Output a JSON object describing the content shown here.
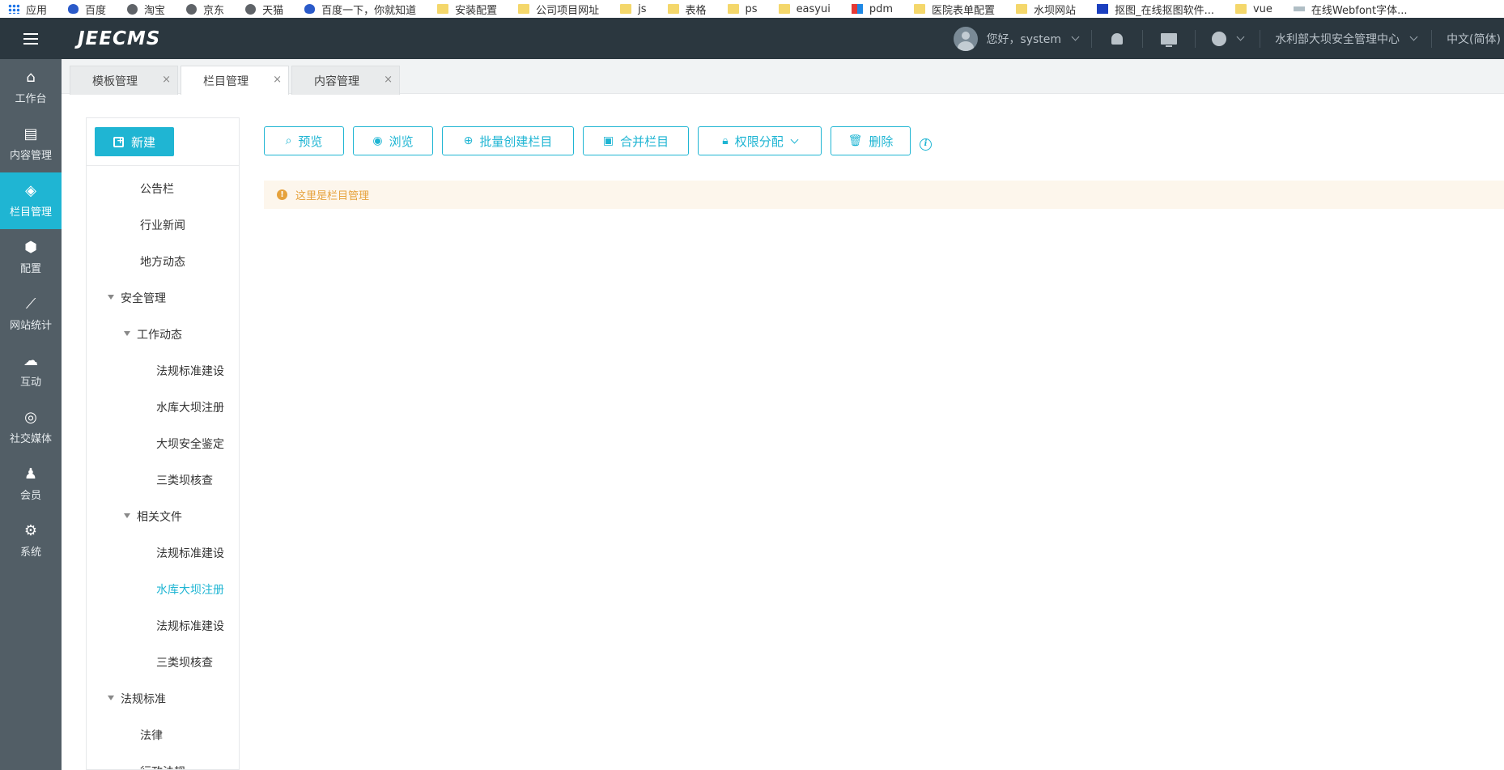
{
  "bookmarks": [
    {
      "label": "应用",
      "icon": "apps"
    },
    {
      "label": "百度",
      "icon": "paw"
    },
    {
      "label": "淘宝",
      "icon": "globe"
    },
    {
      "label": "京东",
      "icon": "globe"
    },
    {
      "label": "天猫",
      "icon": "globe"
    },
    {
      "label": "百度一下，你就知道",
      "icon": "paw"
    },
    {
      "label": "安装配置",
      "icon": "folder"
    },
    {
      "label": "公司项目网址",
      "icon": "folder"
    },
    {
      "label": "js",
      "icon": "folder"
    },
    {
      "label": "表格",
      "icon": "folder"
    },
    {
      "label": "ps",
      "icon": "folder"
    },
    {
      "label": "easyui",
      "icon": "folder"
    },
    {
      "label": "pdm",
      "icon": "pdm"
    },
    {
      "label": "医院表单配置",
      "icon": "folder"
    },
    {
      "label": "水坝网站",
      "icon": "folder"
    },
    {
      "label": "抠图_在线抠图软件...",
      "icon": "kou"
    },
    {
      "label": "vue",
      "icon": "folder"
    },
    {
      "label": "在线Webfont字体...",
      "icon": "web"
    }
  ],
  "header": {
    "logo": "JEECMS",
    "user_greeting": "您好，system",
    "site_name": "水利部大坝安全管理中心",
    "language": "中文(简体)"
  },
  "sidebar": {
    "items": [
      {
        "label": "工作台",
        "icon": "home-icon",
        "glyph": "⌂"
      },
      {
        "label": "内容管理",
        "icon": "document-icon",
        "glyph": "▤"
      },
      {
        "label": "栏目管理",
        "icon": "layers-icon",
        "glyph": "◈"
      },
      {
        "label": "配置",
        "icon": "cube-icon",
        "glyph": "⬢"
      },
      {
        "label": "网站统计",
        "icon": "chart-icon",
        "glyph": "⟋"
      },
      {
        "label": "互动",
        "icon": "chat-icon",
        "glyph": "☁"
      },
      {
        "label": "社交媒体",
        "icon": "target-icon",
        "glyph": "◎"
      },
      {
        "label": "会员",
        "icon": "member-icon",
        "glyph": "♟"
      },
      {
        "label": "系统",
        "icon": "gear-icon",
        "glyph": "⚙"
      }
    ]
  },
  "tabs": [
    {
      "label": "模板管理",
      "close": "×"
    },
    {
      "label": "栏目管理",
      "close": "×"
    },
    {
      "label": "内容管理",
      "close": "×"
    }
  ],
  "tree": {
    "new_button": "新建",
    "nodes": [
      {
        "label": "公告栏"
      },
      {
        "label": "行业新闻"
      },
      {
        "label": "地方动态"
      },
      {
        "label": "安全管理"
      },
      {
        "label": "工作动态"
      },
      {
        "label": "法规标准建设"
      },
      {
        "label": "水库大坝注册"
      },
      {
        "label": "大坝安全鉴定"
      },
      {
        "label": "三类坝核查"
      },
      {
        "label": "相关文件"
      },
      {
        "label": "法规标准建设"
      },
      {
        "label": "水库大坝注册"
      },
      {
        "label": "法规标准建设"
      },
      {
        "label": "三类坝核查"
      },
      {
        "label": "法规标准"
      },
      {
        "label": "法律"
      },
      {
        "label": "行政法规"
      }
    ]
  },
  "toolbar": {
    "preview": "预览",
    "browse": "浏览",
    "batch_create": "批量创建栏目",
    "merge": "合并栏目",
    "permission": "权限分配",
    "delete": "删除",
    "info": "i"
  },
  "notice": {
    "text": "这里是栏目管理",
    "icon": "!"
  },
  "colors": {
    "accent": "#1fb5d3",
    "header_bg": "#2b373f",
    "sidebar_bg": "#525e66",
    "notice_bg": "#fdf6ec",
    "notice_text": "#e6a23c"
  }
}
